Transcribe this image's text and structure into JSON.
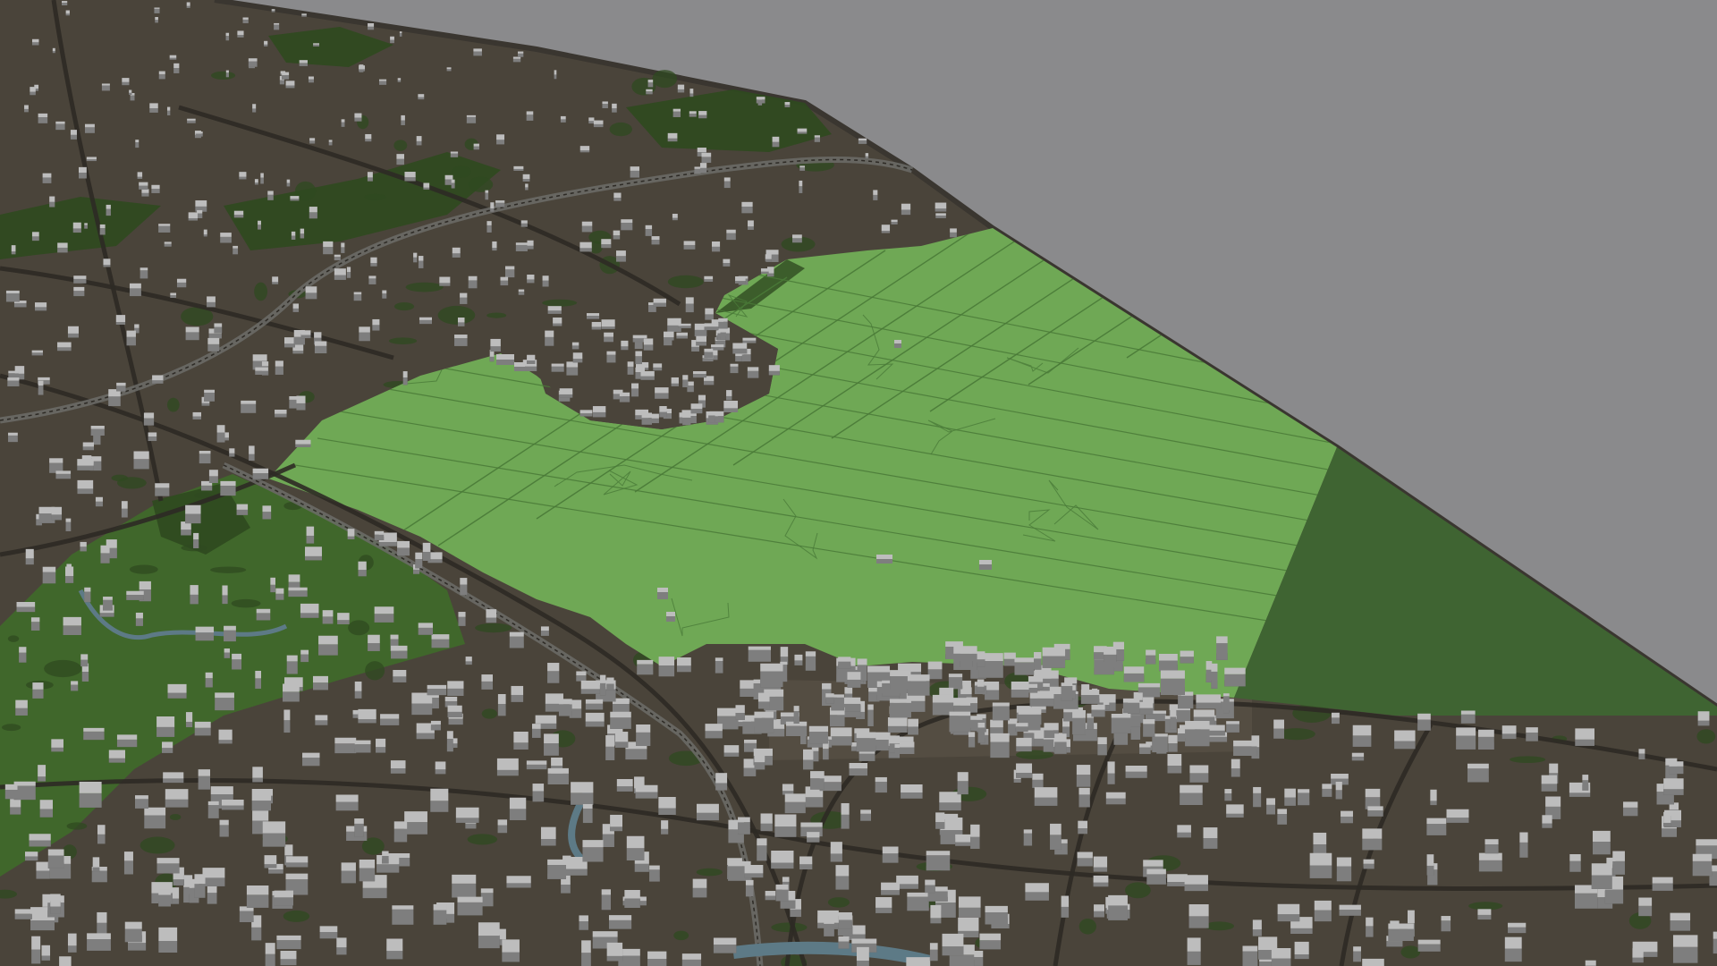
{
  "scene": {
    "view": "3d-city-model-perspective",
    "colors": {
      "sky": "#8a8a8c",
      "ground": "#4a443a",
      "ground_light": "#5b5447",
      "edge": "#3a3630",
      "green_dark": "#2f4a20",
      "green_mid": "#3f6a2a",
      "park_bright": "#6fa855",
      "park_line": "#4a7a38",
      "forest_shadow": "#3f6432",
      "road": "#2d2a25",
      "rail": "#6c6c68",
      "water": "#5d7a86",
      "building_top": "#bdbdbd",
      "building_side": "#7e7e7e",
      "building_shadow": "#5a5a58"
    },
    "layers": [
      "terrain-edge",
      "urban-ground",
      "green-areas",
      "large-park",
      "park-paths",
      "roads",
      "railway",
      "water",
      "buildings"
    ]
  }
}
